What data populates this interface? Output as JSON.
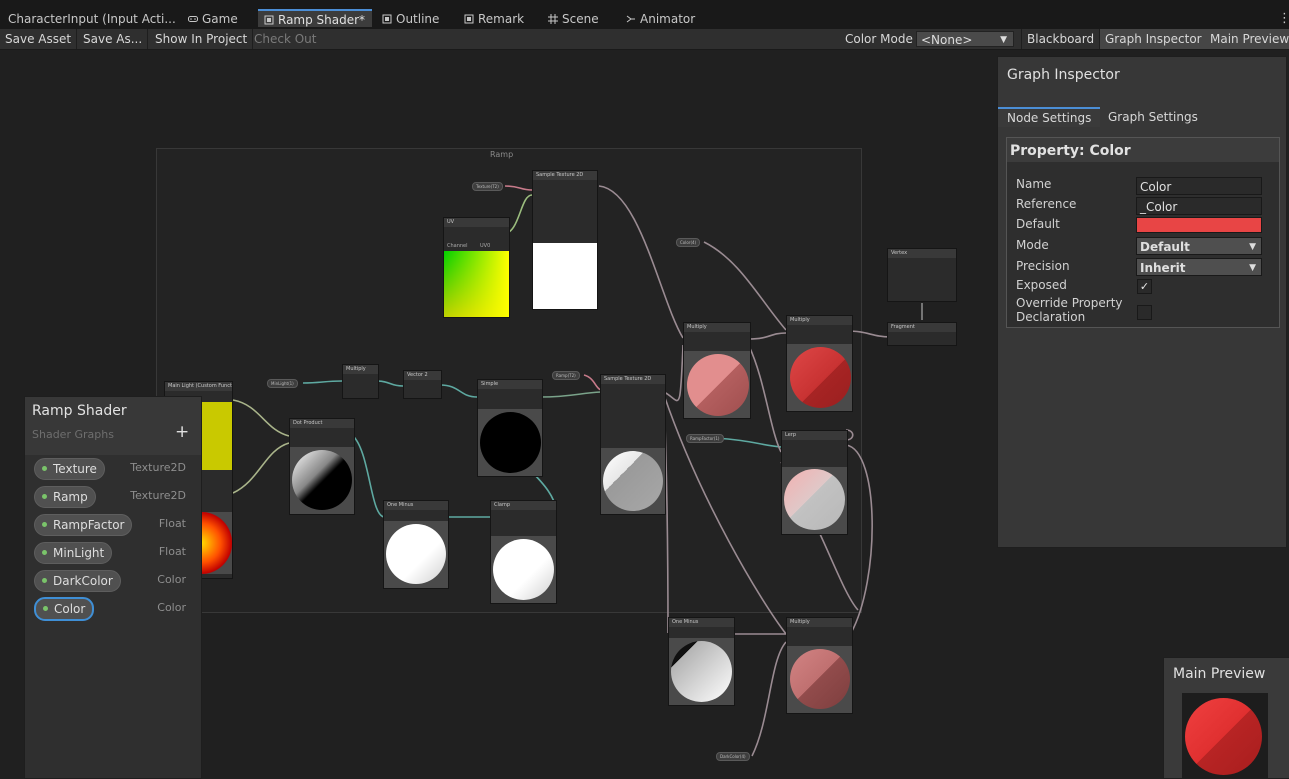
{
  "tabs": [
    {
      "label": "CharacterInput (Input Acti...",
      "icon": ""
    },
    {
      "label": "Game",
      "icon": "gamepad-icon"
    },
    {
      "label": "Ramp Shader*",
      "icon": "shader-graph-icon"
    },
    {
      "label": "Outline",
      "icon": "shader-graph-icon"
    },
    {
      "label": "Remark",
      "icon": "shader-graph-icon"
    },
    {
      "label": "Scene",
      "icon": "grid-icon"
    },
    {
      "label": "Animator",
      "icon": "animator-icon"
    }
  ],
  "toolbar": {
    "save_asset": "Save Asset",
    "save_as": "Save As...",
    "show_in_project": "Show In Project",
    "check_out": "Check Out",
    "color_mode_label": "Color Mode",
    "color_mode_value": "<None>",
    "blackboard": "Blackboard",
    "graph_inspector": "Graph Inspector",
    "main_preview": "Main Preview"
  },
  "graph": {
    "group_title": "Ramp",
    "nodes": {
      "sample_texture_top": "Sample Texture 2D",
      "uv": "UV",
      "uv_channel": "Channel",
      "uv_channel_value": "UV0",
      "vertex": "Vertex",
      "fragment": "Fragment",
      "multiply_1": "Multiply",
      "multiply_2": "Multiply",
      "multiply_3": "Multiply",
      "multiply_small": "Multiply",
      "vector2": "Vector 2",
      "dot_product": "Dot Product",
      "one_minus_1": "One Minus",
      "one_minus_2": "One Minus",
      "clamp": "Clamp",
      "sample_ramp": "Sample Texture 2D",
      "simple": "Simple",
      "lerp": "Lerp",
      "main_light": "Main Light (Custom Function)"
    },
    "pills": {
      "texture": "Texture(T2)",
      "color": "Color(4)",
      "ramp": "Ramp(T2)",
      "min_light": "MinLight(1)",
      "ramp_factor": "RampFactor(1)",
      "dark_color": "DarkColor(4)"
    }
  },
  "blackboard": {
    "title": "Ramp Shader",
    "subtitle": "Shader Graphs",
    "add": "+",
    "properties": [
      {
        "name": "Texture",
        "type": "Texture2D"
      },
      {
        "name": "Ramp",
        "type": "Texture2D"
      },
      {
        "name": "RampFactor",
        "type": "Float"
      },
      {
        "name": "MinLight",
        "type": "Float"
      },
      {
        "name": "DarkColor",
        "type": "Color"
      },
      {
        "name": "Color",
        "type": "Color",
        "selected": true
      }
    ]
  },
  "inspector": {
    "title": "Graph Inspector",
    "tab_node": "Node Settings",
    "tab_graph": "Graph Settings",
    "property_title": "Property: Color",
    "name_label": "Name",
    "name_value": "Color",
    "reference_label": "Reference",
    "reference_value": "_Color",
    "default_label": "Default",
    "default_color": "#e84545",
    "mode_label": "Mode",
    "mode_value": "Default",
    "precision_label": "Precision",
    "precision_value": "Inherit",
    "exposed_label": "Exposed",
    "exposed_checked": true,
    "override_label_1": "Override Property",
    "override_label_2": "Declaration",
    "override_checked": false
  },
  "main_preview": {
    "title": "Main Preview"
  },
  "colors": {
    "accent": "#4b8ed6",
    "property_dot": "#7ac46a"
  }
}
